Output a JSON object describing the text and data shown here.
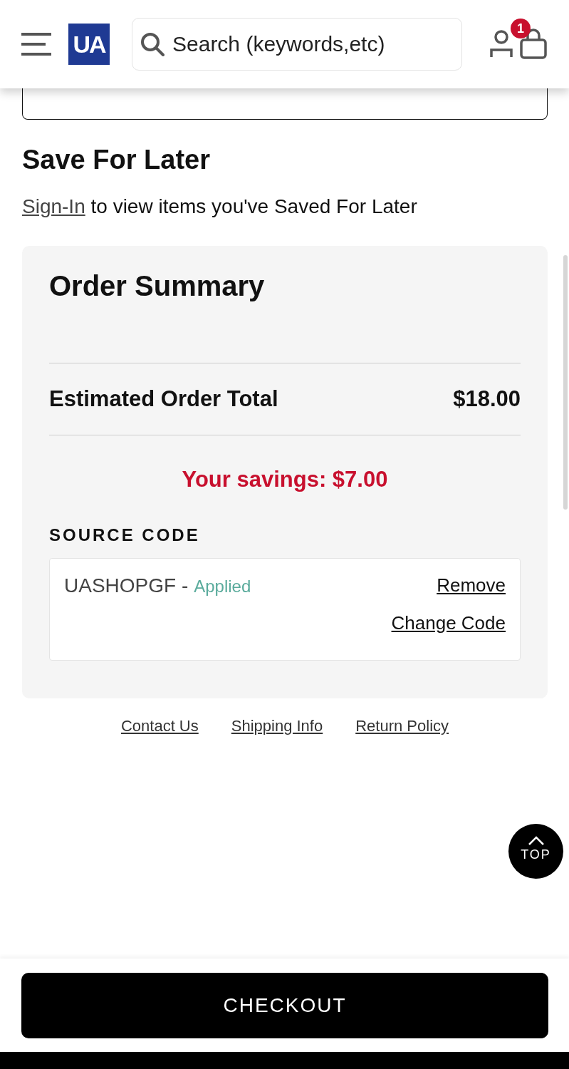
{
  "header": {
    "logo": "UA",
    "search": {
      "placeholder": "Search (keywords,etc)"
    },
    "cart_count": "1"
  },
  "save_for_later": {
    "title": "Save For Later",
    "link": "Sign-In",
    "text": "to view items you've Saved For Later"
  },
  "order_summary": {
    "title": "Order Summary",
    "total_label": "Estimated Order Total",
    "total": "$18.00",
    "savings": "Your savings: $7.00",
    "source_code": {
      "label": "SOURCE CODE",
      "code": "UASHOPGF -",
      "status": "Applied",
      "actions": [
        "Remove",
        "Change Code"
      ]
    }
  },
  "footer_links": [
    "Contact Us",
    "Shipping Info",
    "Return Policy"
  ],
  "top_button": "TOP",
  "checkout_button": "CHECKOUT"
}
